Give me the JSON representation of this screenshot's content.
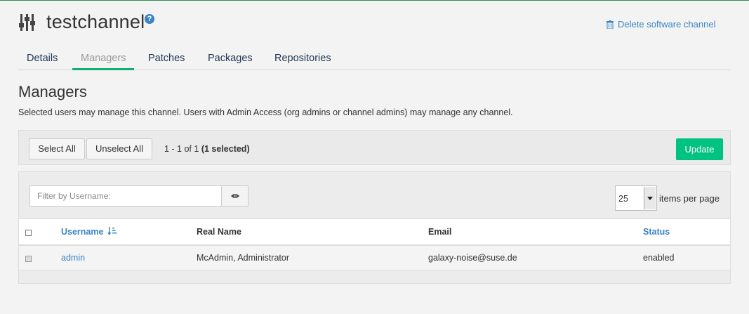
{
  "header": {
    "title": "testchannel",
    "help_icon": "?",
    "delete_label": "Delete software channel"
  },
  "tabs": [
    {
      "label": "Details",
      "active": false
    },
    {
      "label": "Managers",
      "active": true
    },
    {
      "label": "Patches",
      "active": false
    },
    {
      "label": "Packages",
      "active": false
    },
    {
      "label": "Repositories",
      "active": false
    }
  ],
  "section": {
    "title": "Managers",
    "description": "Selected users may manage this channel. Users with Admin Access (org admins or channel admins) may manage any channel."
  },
  "actions": {
    "select_all": "Select All",
    "unselect_all": "Unselect All",
    "count_range": "1 - 1 of 1",
    "count_selected": "(1 selected)",
    "update": "Update"
  },
  "filter": {
    "placeholder": "Filter by Username:",
    "icon": "eye-icon"
  },
  "pagination": {
    "per_page": "25",
    "per_page_label": "items per page"
  },
  "table": {
    "headers": {
      "username": "Username",
      "realname": "Real Name",
      "email": "Email",
      "status": "Status"
    },
    "rows": [
      {
        "username": "admin",
        "realname": "McAdmin, Administrator",
        "email": "galaxy-noise@suse.de",
        "status": "enabled",
        "checked": true
      }
    ]
  },
  "colors": {
    "accent_green": "#00c281",
    "tab_underline": "#10b074",
    "link_blue": "#3a84c3"
  }
}
